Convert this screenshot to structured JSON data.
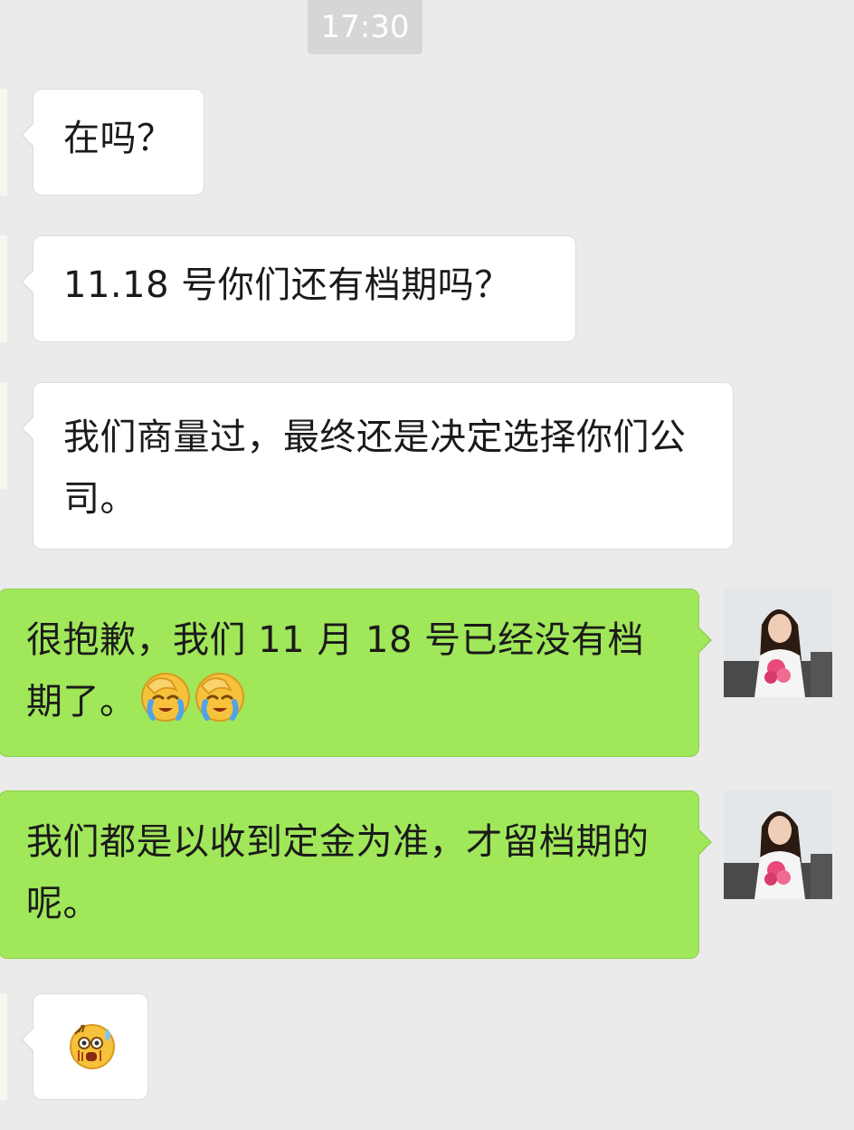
{
  "timestamp": "17:30",
  "messages": [
    {
      "side": "in",
      "text": "在吗？"
    },
    {
      "side": "in",
      "text": "11.18 号你们还有档期吗？"
    },
    {
      "side": "in",
      "text": "我们商量过，最终还是决定选择你们公司。"
    },
    {
      "side": "out",
      "text": "很抱歉，我们 11 月 18 号已经没有档期了。",
      "emojis": [
        "facepalm-cry-emoji",
        "facepalm-cry-emoji"
      ]
    },
    {
      "side": "out",
      "text": "我们都是以收到定金为准，才留档期的呢。"
    },
    {
      "side": "in",
      "text": "",
      "emojis": [
        "shocked-sweat-emoji"
      ]
    }
  ],
  "colors": {
    "background": "#ebebeb",
    "incoming_bubble": "#ffffff",
    "outgoing_bubble": "#a0e75a",
    "timestamp_bg": "#d6d6d6"
  }
}
